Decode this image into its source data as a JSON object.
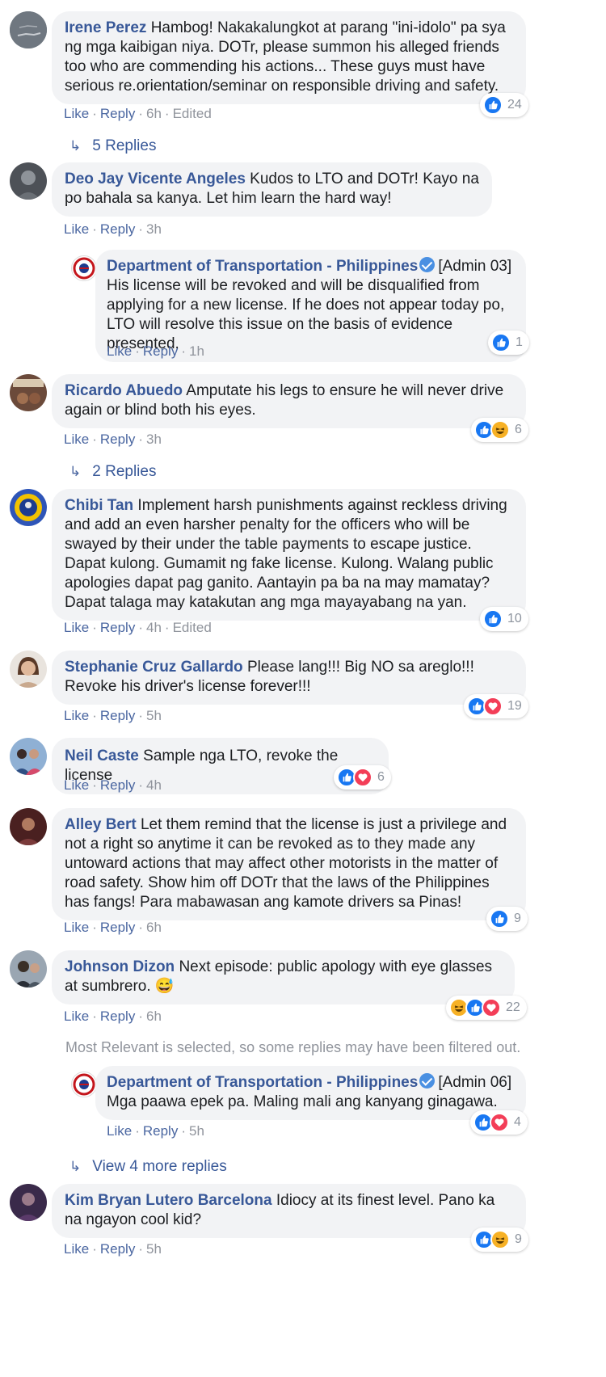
{
  "labels": {
    "like": "Like",
    "reply": "Reply",
    "dot": "·",
    "edited": "Edited"
  },
  "comments": [
    {
      "name": "Irene Perez",
      "text": "Hambog! Nakakalungkot at parang \"ini-idolo\" pa sya ng mga kaibigan niya. DOTr, please summon his alleged friends too who are commending his actions... These guys must have serious re.orientation/seminar on responsible driving and safety.",
      "time": "6h",
      "reaction_count": "24",
      "reactions": [
        "like"
      ],
      "avatar_color": "#7a828c"
    },
    {
      "name": "Deo Jay Vicente Angeles",
      "text": "Kudos to LTO and DOTr! Kayo na po bahala sa kanya. Let him learn the hard way!",
      "time": "3h",
      "avatar_color": "#4d5157"
    },
    {
      "name": "Department of Transportation - Philippines",
      "admin": "[Admin 03]",
      "text": "His license will be revoked and will be disqualified from applying for a new license. If he does not appear today po, LTO will resolve this issue on the basis of evidence presented.",
      "time": "1h",
      "reaction_count": "1",
      "reactions": [
        "like"
      ]
    },
    {
      "name": "Ricardo Abuedo",
      "text": "Amputate his legs to ensure he will never drive again or blind both his eyes.",
      "time": "3h",
      "reaction_count": "6",
      "reactions": [
        "like",
        "haha"
      ],
      "avatar_color": "#6b4a3a"
    },
    {
      "name": "Chibi Tan",
      "text": "Implement harsh punishments against reckless driving and add an even harsher penalty for the officers who will be swayed by their under the table payments to escape justice. Dapat kulong. Gumamit ng fake license. Kulong. Walang public apologies dapat pag ganito. Aantayin pa ba na may mamatay? Dapat talaga may katakutan ang mga mayayabang na yan.",
      "time": "4h",
      "reaction_count": "10",
      "reactions": [
        "like"
      ],
      "avatar_color": "#2e55b8"
    },
    {
      "name": "Stephanie Cruz Gallardo",
      "text": "Please lang!!! Big NO sa areglo!!! Revoke his driver's license forever!!!",
      "time": "5h",
      "reaction_count": "19",
      "reactions": [
        "like",
        "love"
      ],
      "avatar_color": "#c9a98e"
    },
    {
      "name": "Neil Caste",
      "text": "Sample nga LTO, revoke the license",
      "time": "4h",
      "reaction_count": "6",
      "reactions": [
        "like",
        "love"
      ],
      "avatar_color": "#5a7ea8"
    },
    {
      "name": "Alley Bert",
      "text": "Let them remind that the license is just a privilege and not a right so anytime it can be revoked as to they made any untoward actions that may affect other motorists in the matter of road safety. Show him off DOTr that the laws of the Philippines has fangs! Para mabawasan ang kamote drivers sa Pinas!",
      "time": "6h",
      "reaction_count": "9",
      "reactions": [
        "like"
      ],
      "avatar_color": "#5a2a2a"
    },
    {
      "name": "Johnson Dizon",
      "text": "Next episode: public apology with eye glasses at sumbrero. 😅",
      "time": "6h",
      "reaction_count": "22",
      "reactions": [
        "haha",
        "like",
        "love"
      ],
      "avatar_color": "#4a5560"
    },
    {
      "name": "Department of Transportation - Philippines",
      "admin": "[Admin 06]",
      "text": "Mga paawa epek pa. Maling mali ang kanyang ginagawa.",
      "time": "5h",
      "reaction_count": "4",
      "reactions": [
        "like",
        "love"
      ]
    },
    {
      "name": "Kim Bryan Lutero Barcelona",
      "text": "Idiocy at its finest level. Pano ka na ngayon cool kid?",
      "time": "5h",
      "reaction_count": "9",
      "reactions": [
        "like",
        "haha"
      ],
      "avatar_color": "#3a2a4a"
    }
  ],
  "reply_links": {
    "irene": "5 Replies",
    "ricardo": "2 Replies",
    "johnson_more": "View 4 more replies"
  },
  "filter_note": "Most Relevant is selected, so some replies may have been filtered out."
}
